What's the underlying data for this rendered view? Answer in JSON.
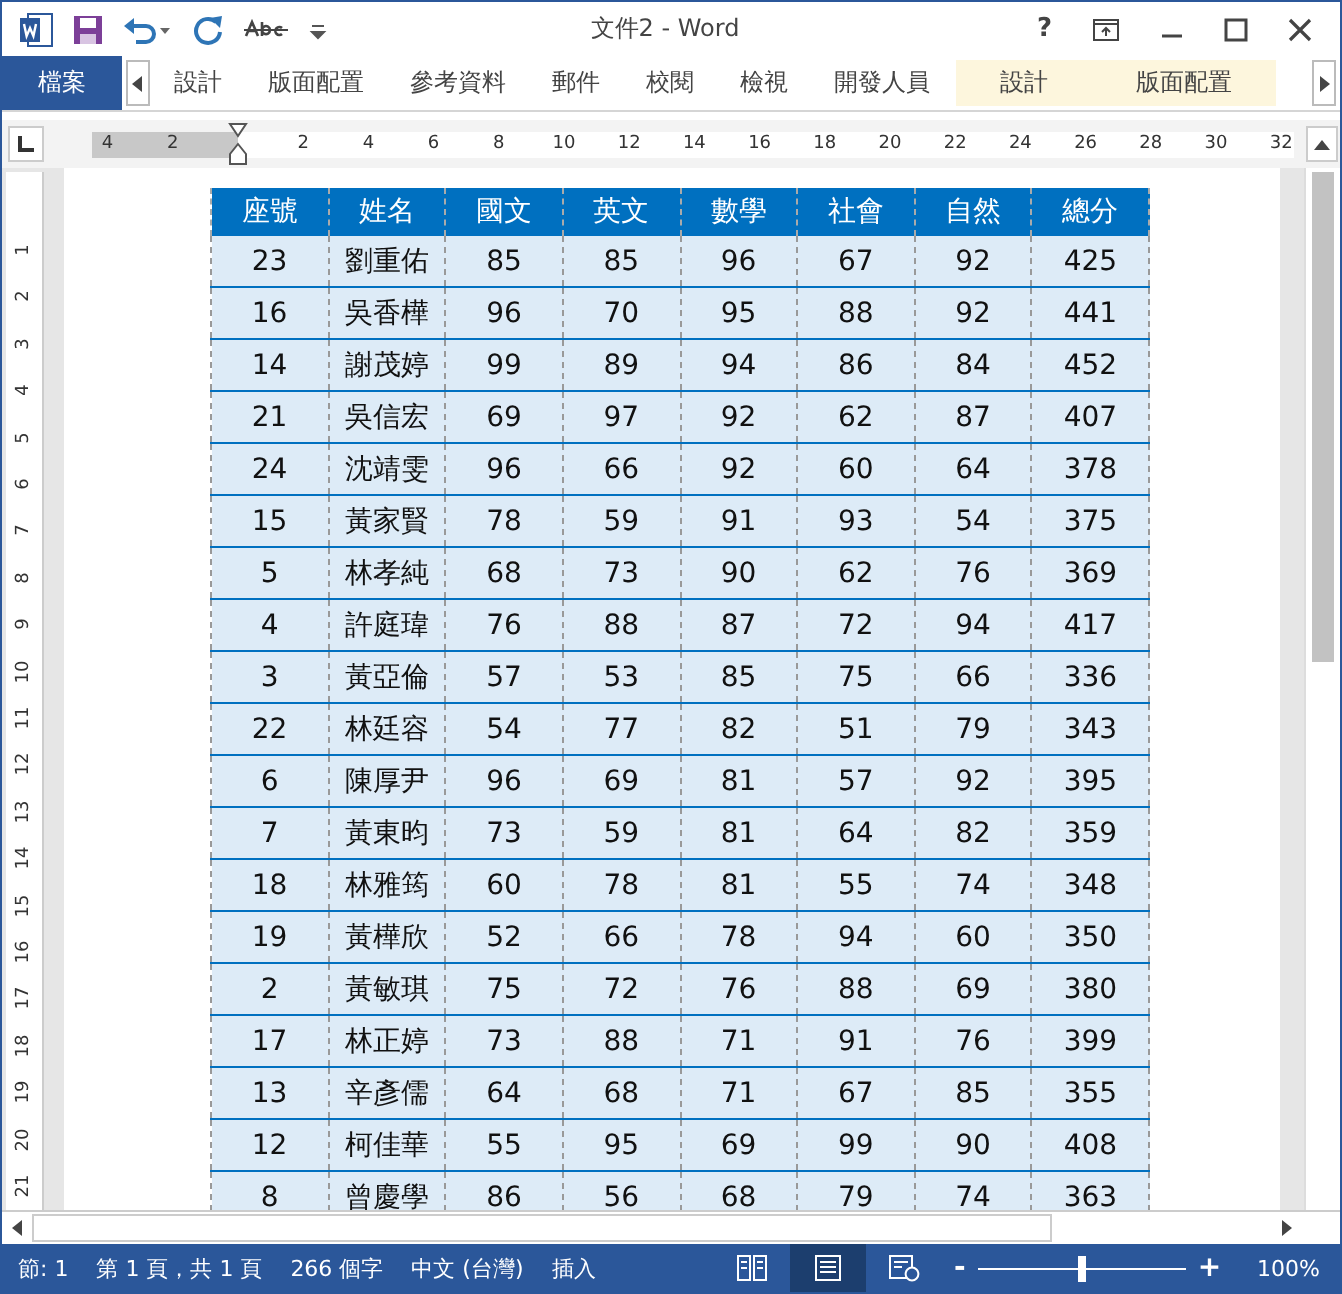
{
  "window": {
    "title": "文件2 - Word",
    "controls": [
      "?"
    ]
  },
  "ribbon": {
    "file_tab": "檔案",
    "tabs": [
      {
        "label": "設計",
        "selected": false,
        "kind": "normal"
      },
      {
        "label": "版面配置",
        "selected": false,
        "kind": "normal"
      },
      {
        "label": "參考資料",
        "selected": false,
        "kind": "normal"
      },
      {
        "label": "郵件",
        "selected": false,
        "kind": "normal"
      },
      {
        "label": "校閱",
        "selected": false,
        "kind": "normal"
      },
      {
        "label": "檢視",
        "selected": false,
        "kind": "normal"
      },
      {
        "label": "開發人員",
        "selected": false,
        "kind": "normal"
      },
      {
        "label": "設計",
        "selected": false,
        "kind": "contextual"
      },
      {
        "label": "版面配置",
        "selected": false,
        "kind": "contextual"
      }
    ]
  },
  "ruler": {
    "labels": [
      "4",
      "2",
      "2",
      "4",
      "6",
      "8",
      "10",
      "12",
      "14",
      "16",
      "18",
      "20",
      "22",
      "24",
      "26",
      "28",
      "30",
      "32"
    ],
    "vertical_labels": [
      "1",
      "2",
      "3",
      "4",
      "5",
      "6",
      "7",
      "8",
      "9",
      "10",
      "11",
      "12",
      "13",
      "14",
      "15",
      "16",
      "17",
      "18",
      "19",
      "20",
      "21"
    ]
  },
  "table": {
    "columns": [
      "座號",
      "姓名",
      "國文",
      "英文",
      "數學",
      "社會",
      "自然",
      "總分"
    ],
    "rows": [
      [
        "23",
        "劉重佑",
        "85",
        "85",
        "96",
        "67",
        "92",
        "425"
      ],
      [
        "16",
        "吳香樺",
        "96",
        "70",
        "95",
        "88",
        "92",
        "441"
      ],
      [
        "14",
        "謝茂婷",
        "99",
        "89",
        "94",
        "86",
        "84",
        "452"
      ],
      [
        "21",
        "吳信宏",
        "69",
        "97",
        "92",
        "62",
        "87",
        "407"
      ],
      [
        "24",
        "沈靖雯",
        "96",
        "66",
        "92",
        "60",
        "64",
        "378"
      ],
      [
        "15",
        "黃家賢",
        "78",
        "59",
        "91",
        "93",
        "54",
        "375"
      ],
      [
        "5",
        "林孝純",
        "68",
        "73",
        "90",
        "62",
        "76",
        "369"
      ],
      [
        "4",
        "許庭瑋",
        "76",
        "88",
        "87",
        "72",
        "94",
        "417"
      ],
      [
        "3",
        "黃亞倫",
        "57",
        "53",
        "85",
        "75",
        "66",
        "336"
      ],
      [
        "22",
        "林廷容",
        "54",
        "77",
        "82",
        "51",
        "79",
        "343"
      ],
      [
        "6",
        "陳厚尹",
        "96",
        "69",
        "81",
        "57",
        "92",
        "395"
      ],
      [
        "7",
        "黃東昀",
        "73",
        "59",
        "81",
        "64",
        "82",
        "359"
      ],
      [
        "18",
        "林雅筠",
        "60",
        "78",
        "81",
        "55",
        "74",
        "348"
      ],
      [
        "19",
        "黃樺欣",
        "52",
        "66",
        "78",
        "94",
        "60",
        "350"
      ],
      [
        "2",
        "黃敏琪",
        "75",
        "72",
        "76",
        "88",
        "69",
        "380"
      ],
      [
        "17",
        "林正婷",
        "73",
        "88",
        "71",
        "91",
        "76",
        "399"
      ],
      [
        "13",
        "辛彥儒",
        "64",
        "68",
        "71",
        "67",
        "85",
        "355"
      ],
      [
        "12",
        "柯佳華",
        "55",
        "95",
        "69",
        "99",
        "90",
        "408"
      ],
      [
        "8",
        "曾慶學",
        "86",
        "56",
        "68",
        "79",
        "74",
        "363"
      ]
    ]
  },
  "status_bar": {
    "items": [
      "節: 1",
      "第 1 頁，共 1 頁",
      "266 個字",
      "中文 (台灣)",
      "插入"
    ],
    "views": [
      {
        "kind": "read",
        "selected": false
      },
      {
        "kind": "print",
        "selected": true
      },
      {
        "kind": "web",
        "selected": false
      }
    ],
    "zoom": {
      "level": 0.5,
      "reading": "100%",
      "minus": "-",
      "plus": "+"
    }
  }
}
